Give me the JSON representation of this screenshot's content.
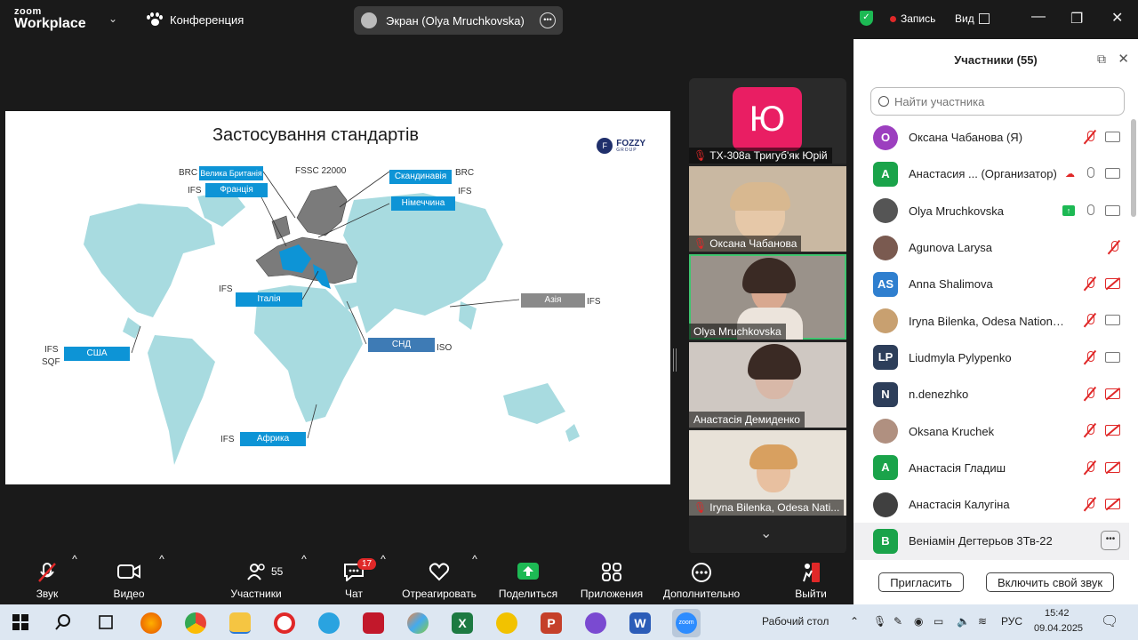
{
  "topbar": {
    "logo_line1": "zoom",
    "logo_line2": "Workplace",
    "meeting_label": "Конференция",
    "screen_share_label": "Экран (Olya Mruchkovska)",
    "record_label": "Запись",
    "view_label": "Вид"
  },
  "slide": {
    "title": "Застосування стандартів",
    "brand": "FOZZY",
    "brand_sub": "GROUP",
    "regions": [
      {
        "label": "Велика Британія",
        "standard": "BRC"
      },
      {
        "label": "Франція",
        "standard": "IFS"
      },
      {
        "label": "Скандинавія",
        "standard": "BRC"
      },
      {
        "label": "Німеччина",
        "standard": "IFS"
      },
      {
        "label": "Італія",
        "standard": "IFS"
      },
      {
        "label": "Азія",
        "standard": "IFS"
      },
      {
        "label": "США",
        "standard": "IFS"
      },
      {
        "label": "СНД",
        "standard": "ISO"
      },
      {
        "label": "Африка",
        "standard": "IFS"
      }
    ],
    "fssc": "FSSC 22000",
    "sqf": "SQF"
  },
  "video_strip": [
    {
      "name": "TX-308a Тригуб'як Юрій",
      "avatar": "Ю",
      "avatar_color": "#e91e63"
    },
    {
      "name": "Оксана Чабанова"
    },
    {
      "name": "Olya Mruchkovska",
      "active": true
    },
    {
      "name": "Анастасія Демиденко"
    },
    {
      "name": "Iryna Bilenka, Odesa Nati..."
    }
  ],
  "panel": {
    "title": "Участники (55)",
    "search_placeholder": "Найти участника",
    "participants": [
      {
        "initials": "О",
        "color": "#9c3fbf",
        "name": "Оксана Чабанова (Я)",
        "icons": [
          "mic-off",
          "cam"
        ]
      },
      {
        "initials": "А",
        "color": "#1aa34a",
        "name": "Анастасия ...  (Организатор)",
        "icons": [
          "cloud",
          "mic",
          "cam"
        ]
      },
      {
        "initials": "",
        "color": "#555555",
        "name": "Olya Mruchkovska",
        "icons": [
          "share",
          "mic",
          "cam"
        ]
      },
      {
        "initials": "",
        "color": "#7a5a50",
        "name": "Agunova Larysa",
        "icons": [
          "mic-off"
        ]
      },
      {
        "initials": "AS",
        "color": "#2f7fcf",
        "name": "Anna Shalimova",
        "icons": [
          "mic-off",
          "cam-off"
        ]
      },
      {
        "initials": "",
        "color": "#c8a070",
        "name": "Iryna Bilenka, Odesa National U...",
        "icons": [
          "mic-off",
          "cam"
        ]
      },
      {
        "initials": "LP",
        "color": "#2d3e5a",
        "name": "Liudmyla Pylypenko",
        "icons": [
          "mic-off",
          "cam"
        ]
      },
      {
        "initials": "N",
        "color": "#2d3e5a",
        "name": "n.denezhko",
        "icons": [
          "mic-off",
          "cam-off"
        ]
      },
      {
        "initials": "",
        "color": "#b09080",
        "name": "Oksana Kruchek",
        "icons": [
          "mic-off",
          "cam-off"
        ]
      },
      {
        "initials": "А",
        "color": "#1aa34a",
        "name": "Анастасія Гладиш",
        "icons": [
          "mic-off",
          "cam-off"
        ]
      },
      {
        "initials": "",
        "color": "#404040",
        "name": "Анастасія Калугіна",
        "icons": [
          "mic-off",
          "cam-off"
        ]
      },
      {
        "initials": "В",
        "color": "#1aa34a",
        "name": "Веніамін Дегтерьов 3Тв-22",
        "icons": [
          "more"
        ]
      }
    ],
    "invite_label": "Пригласить",
    "unmute_label": "Включить свой звук"
  },
  "toolbar": {
    "audio": "Звук",
    "video": "Видео",
    "participants": "Участники",
    "participants_count": "55",
    "chat": "Чат",
    "chat_badge": "17",
    "react": "Отреагировать",
    "share": "Поделиться",
    "apps": "Приложения",
    "more": "Дополнительно",
    "leave": "Выйти"
  },
  "taskbar": {
    "desktop_label": "Рабочий стол",
    "lang": "РУС",
    "time": "15:42",
    "date": "09.04.2025"
  },
  "colors": {
    "accent_green": "#3ec56f",
    "danger_red": "#e02828",
    "map_sea_blue": "#0d94d6"
  }
}
